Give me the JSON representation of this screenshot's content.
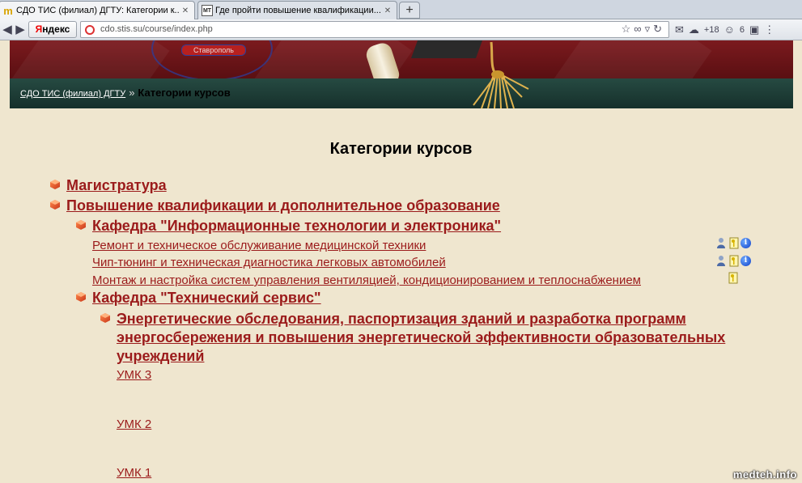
{
  "browser": {
    "tabs": [
      {
        "label": "СДО ТИС (филиал) ДГТУ: Категории к...",
        "close": "✕"
      },
      {
        "label": "Где пройти повышение квалификации...",
        "close": "✕"
      }
    ],
    "new_tab": "+",
    "yandex": {
      "first": "Я",
      "rest": "ндекс"
    },
    "url": "cdo.stis.su/course/index.php",
    "weather": "+18",
    "count": "6"
  },
  "header": {
    "seal_text": "Ставрополь",
    "breadcrumb": {
      "home": "СДО ТИС (филиал) ДГТУ",
      "separator": "»",
      "current": "Категории курсов"
    }
  },
  "main": {
    "title": "Категории курсов",
    "categories": [
      {
        "label": "Магистратура"
      },
      {
        "label": "Повышение квалификации и дополнительное образование"
      },
      {
        "label": "Кафедра \"Информационные технологии и электроника\""
      },
      {
        "label": "Кафедра \"Технический сервис\""
      },
      {
        "label": "Энергетические обследования, паспортизация зданий и разработка программ энергосбережения и повышения энергетической эффективности образовательных учреждений"
      }
    ],
    "courses": [
      {
        "label": "Ремонт и техническое обслуживание медицинской техники"
      },
      {
        "label": "Чип-тюнинг и техническая диагностика легковых автомобилей"
      },
      {
        "label": "Монтаж и настройка систем управления вентиляцией, кондиционированием и теплоснабжением"
      },
      {
        "label": "УМК  3"
      },
      {
        "label": "УМК  2"
      },
      {
        "label": "УМК  1"
      }
    ],
    "info_glyph": "i"
  },
  "watermark": "medteh.info",
  "colors": {
    "link": "#9b1b1b",
    "page_bg": "#efe6cf",
    "banner": "#6b1519",
    "breadcrumb_bar": "#1f3f38"
  }
}
